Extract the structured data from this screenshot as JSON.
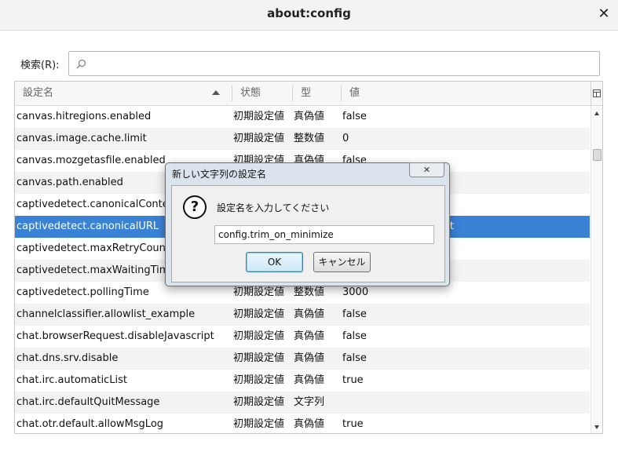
{
  "window": {
    "title": "about:config",
    "close_glyph": "✕"
  },
  "search": {
    "label": "検索(R):",
    "placeholder": "",
    "icon": "search-icon"
  },
  "columns": {
    "name": "設定名",
    "status": "状態",
    "type": "型",
    "value": "値"
  },
  "rows": [
    {
      "name": "canvas.hitregions.enabled",
      "status": "初期設定値",
      "type": "真偽値",
      "value": "false"
    },
    {
      "name": "canvas.image.cache.limit",
      "status": "初期設定値",
      "type": "整数値",
      "value": "0"
    },
    {
      "name": "canvas.mozgetasfile.enabled",
      "status": "初期設定値",
      "type": "真偽値",
      "value": "false"
    },
    {
      "name": "canvas.path.enabled",
      "status": "",
      "type": "",
      "value": ""
    },
    {
      "name": "captivedetect.canonicalConte",
      "status": "",
      "type": "",
      "value": ""
    },
    {
      "name": "captivedetect.canonicalURL",
      "status": "",
      "type": "",
      "value": "refox.com/success.txt",
      "selected": true
    },
    {
      "name": "captivedetect.maxRetryCoun",
      "status": "",
      "type": "",
      "value": ""
    },
    {
      "name": "captivedetect.maxWaitingTim",
      "status": "",
      "type": "",
      "value": ""
    },
    {
      "name": "captivedetect.pollingTime",
      "status": "初期設定値",
      "type": "整数値",
      "value": "3000"
    },
    {
      "name": "channelclassifier.allowlist_example",
      "status": "初期設定値",
      "type": "真偽値",
      "value": "false"
    },
    {
      "name": "chat.browserRequest.disableJavascript",
      "status": "初期設定値",
      "type": "真偽値",
      "value": "false"
    },
    {
      "name": "chat.dns.srv.disable",
      "status": "初期設定値",
      "type": "真偽値",
      "value": "false"
    },
    {
      "name": "chat.irc.automaticList",
      "status": "初期設定値",
      "type": "真偽値",
      "value": "true"
    },
    {
      "name": "chat.irc.defaultQuitMessage",
      "status": "初期設定値",
      "type": "文字列",
      "value": ""
    },
    {
      "name": "chat.otr.default.allowMsgLog",
      "status": "初期設定値",
      "type": "真偽値",
      "value": "true"
    }
  ],
  "dialog": {
    "title": "新しい文字列の設定名",
    "close_glyph": "✕",
    "message": "設定名を入力してください",
    "input_value": "config.trim_on_minimize",
    "ok_label": "OK",
    "cancel_label": "キャンセル",
    "icon": "question-icon",
    "icon_glyph": "?"
  },
  "colors": {
    "selection": "#3a82d6",
    "stripe": "#f3f3f3"
  }
}
